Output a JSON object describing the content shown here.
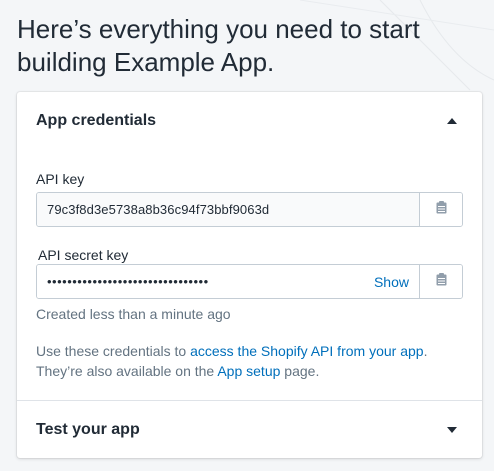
{
  "page": {
    "title": "Here’s everything you need to start building Example App."
  },
  "credentials": {
    "section_title": "App credentials",
    "api_key": {
      "label": "API key",
      "value": "79c3f8d3e5738a8b36c94f73bbf9063d"
    },
    "api_secret_key": {
      "label": "API secret key",
      "masked_value": "••••••••••••••••••••••••••••••••",
      "show_label": "Show"
    },
    "created_note": "Created less than a minute ago",
    "info": {
      "prefix": "Use these credentials to ",
      "api_link": "access the Shopify API from your app",
      "middle": ". They’re also available on the ",
      "setup_link": "App setup",
      "suffix": " page."
    }
  },
  "test_section": {
    "section_title": "Test your app"
  },
  "colors": {
    "link": "#006fbb",
    "text": "#212b36",
    "subdued": "#637381",
    "background": "#f4f6f8"
  },
  "icons": {
    "collapse": "caret-up-icon",
    "expand": "caret-down-icon",
    "copy": "clipboard-icon"
  }
}
